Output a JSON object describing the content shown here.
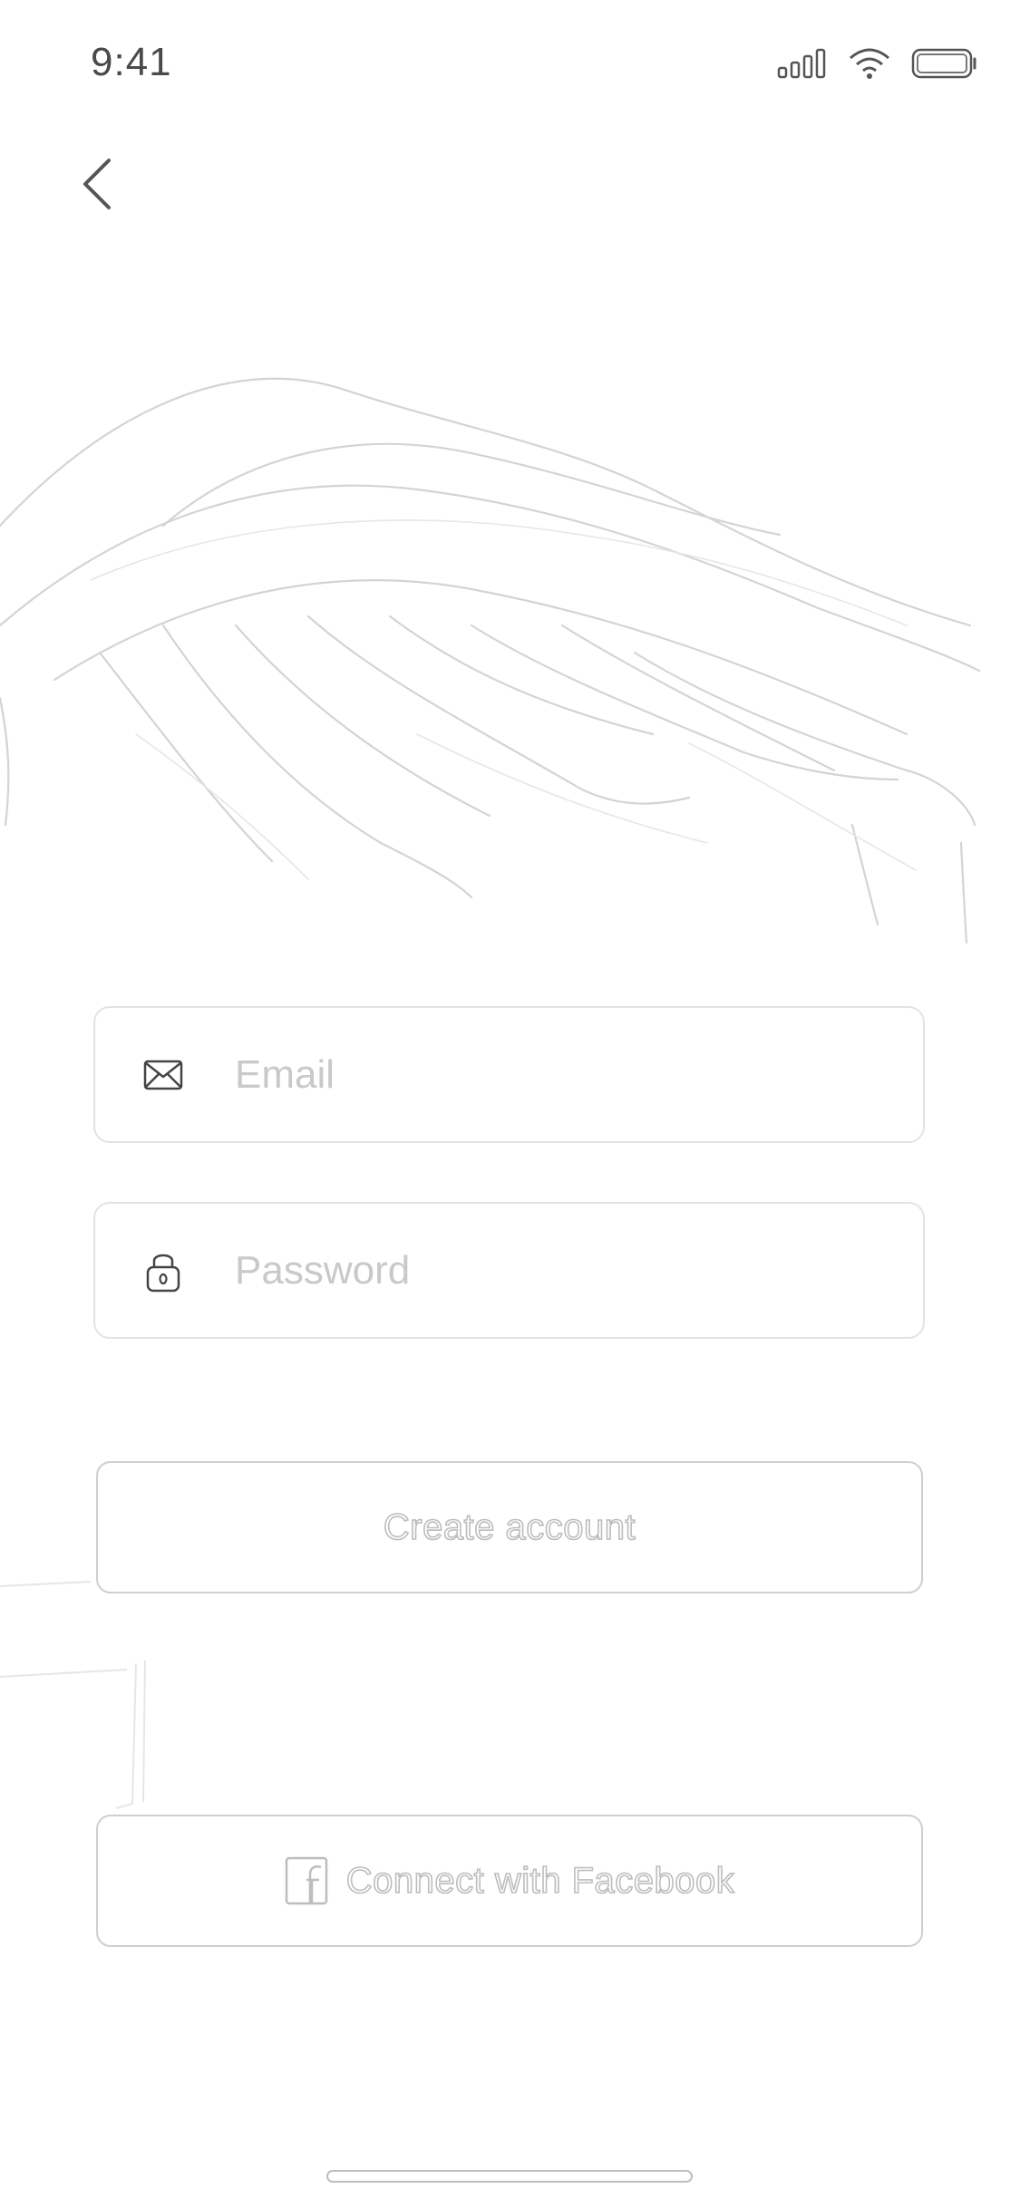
{
  "status_bar": {
    "time": "9:41",
    "icons": [
      "signal-icon",
      "wifi-icon",
      "battery-icon"
    ]
  },
  "navigation": {
    "back_icon": "chevron-left-icon"
  },
  "form": {
    "email": {
      "placeholder": "Email",
      "value": "",
      "icon": "envelope-icon"
    },
    "password": {
      "placeholder": "Password",
      "value": "",
      "icon": "lock-icon"
    }
  },
  "actions": {
    "create_account_label": "Create account",
    "facebook_label": "Connect with Facebook",
    "facebook_icon": "facebook-icon"
  },
  "colors": {
    "background": "#ffffff",
    "border": "#e3e3e3",
    "placeholder": "#c9c9c9",
    "text": "#4a4a4a"
  }
}
